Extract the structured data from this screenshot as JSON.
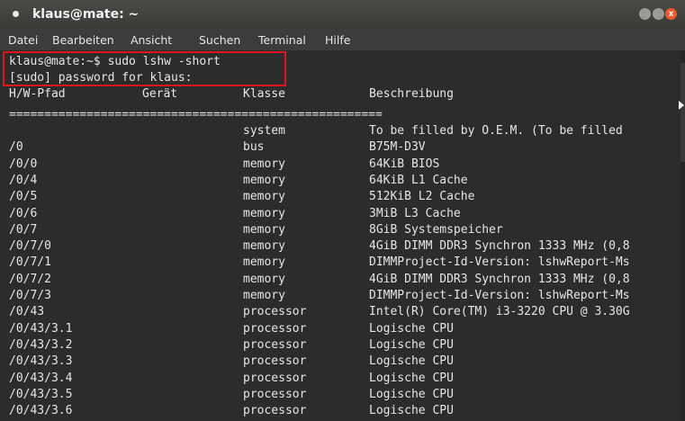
{
  "window": {
    "title": "klaus@mate: ~",
    "controls": {
      "minimize": "",
      "maximize": "",
      "close": "x"
    }
  },
  "menubar": {
    "items": [
      "Datei",
      "Bearbeiten",
      "Ansicht",
      "Suchen",
      "Terminal",
      "Hilfe"
    ]
  },
  "terminal": {
    "command_line": "klaus@mate:~$ sudo lshw -short",
    "password_prompt": "[sudo] password for klaus:",
    "header": {
      "path": "H/W-Pfad",
      "device": "Gerät",
      "class": "Klasse",
      "description": "Beschreibung"
    },
    "separator": "=====================================================",
    "rows": [
      {
        "path": "",
        "device": "",
        "class": "system",
        "description": "To be filled by O.E.M. (To be filled"
      },
      {
        "path": "/0",
        "device": "",
        "class": "bus",
        "description": "B75M-D3V"
      },
      {
        "path": "/0/0",
        "device": "",
        "class": "memory",
        "description": "64KiB BIOS"
      },
      {
        "path": "/0/4",
        "device": "",
        "class": "memory",
        "description": "64KiB L1 Cache"
      },
      {
        "path": "/0/5",
        "device": "",
        "class": "memory",
        "description": "512KiB L2 Cache"
      },
      {
        "path": "/0/6",
        "device": "",
        "class": "memory",
        "description": "3MiB L3 Cache"
      },
      {
        "path": "/0/7",
        "device": "",
        "class": "memory",
        "description": "8GiB Systemspeicher"
      },
      {
        "path": "/0/7/0",
        "device": "",
        "class": "memory",
        "description": "4GiB DIMM DDR3 Synchron 1333 MHz (0,8"
      },
      {
        "path": "/0/7/1",
        "device": "",
        "class": "memory",
        "description": "DIMMProject-Id-Version: lshwReport-Ms"
      },
      {
        "path": "/0/7/2",
        "device": "",
        "class": "memory",
        "description": "4GiB DIMM DDR3 Synchron 1333 MHz (0,8"
      },
      {
        "path": "/0/7/3",
        "device": "",
        "class": "memory",
        "description": "DIMMProject-Id-Version: lshwReport-Ms"
      },
      {
        "path": "/0/43",
        "device": "",
        "class": "processor",
        "description": "Intel(R) Core(TM) i3-3220 CPU @ 3.30G"
      },
      {
        "path": "/0/43/3.1",
        "device": "",
        "class": "processor",
        "description": "Logische CPU"
      },
      {
        "path": "/0/43/3.2",
        "device": "",
        "class": "processor",
        "description": "Logische CPU"
      },
      {
        "path": "/0/43/3.3",
        "device": "",
        "class": "processor",
        "description": "Logische CPU"
      },
      {
        "path": "/0/43/3.4",
        "device": "",
        "class": "processor",
        "description": "Logische CPU"
      },
      {
        "path": "/0/43/3.5",
        "device": "",
        "class": "processor",
        "description": "Logische CPU"
      },
      {
        "path": "/0/43/3.6",
        "device": "",
        "class": "processor",
        "description": "Logische CPU"
      }
    ]
  },
  "colors": {
    "highlight_border": "#e0141c",
    "close_button": "#f05a2a",
    "terminal_background": "#2c2c2c",
    "terminal_text": "#e6e6e6"
  }
}
